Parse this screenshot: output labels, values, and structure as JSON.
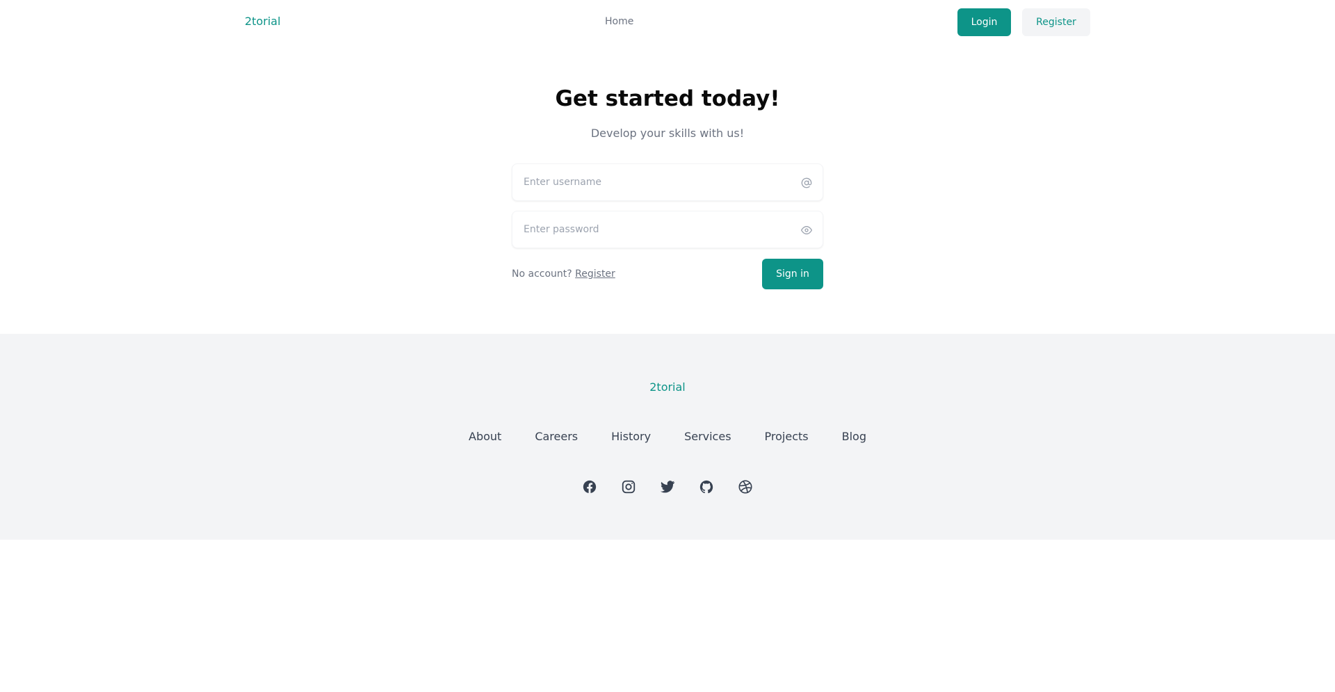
{
  "header": {
    "brand": "2torial",
    "nav_home": "Home",
    "login_label": "Login",
    "register_label": "Register"
  },
  "main": {
    "title": "Get started today!",
    "subtitle": "Develop your skills with us!",
    "username_placeholder": "Enter username",
    "password_placeholder": "Enter password",
    "no_account_text": "No account?",
    "register_link": "Register",
    "signin_label": "Sign in"
  },
  "footer": {
    "brand": "2torial",
    "links": [
      "About",
      "Careers",
      "History",
      "Services",
      "Projects",
      "Blog"
    ],
    "social_icons": [
      "facebook-icon",
      "instagram-icon",
      "twitter-icon",
      "github-icon",
      "dribbble-icon"
    ]
  },
  "colors": {
    "accent": "#0d9488",
    "footer_bg": "#f3f4f6",
    "muted_text": "#6b7280"
  }
}
